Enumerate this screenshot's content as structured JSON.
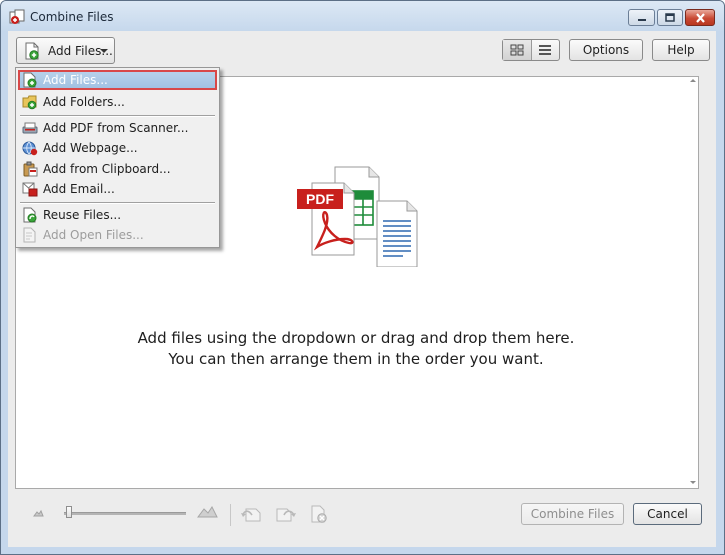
{
  "window": {
    "title": "Combine Files"
  },
  "toolbar": {
    "add_files_label": "Add Files...",
    "options_label": "Options",
    "help_label": "Help"
  },
  "menu": {
    "items": [
      {
        "label": "Add Files...",
        "icon": "add-files-icon",
        "highlighted": true,
        "enabled": true
      },
      {
        "label": "Add Folders...",
        "icon": "add-folder-icon",
        "enabled": true
      },
      {
        "label": "Add PDF from Scanner...",
        "icon": "scanner-icon",
        "enabled": true
      },
      {
        "label": "Add Webpage...",
        "icon": "webpage-icon",
        "enabled": true
      },
      {
        "label": "Add from Clipboard...",
        "icon": "clipboard-icon",
        "enabled": true
      },
      {
        "label": "Add Email...",
        "icon": "email-icon",
        "enabled": true
      },
      {
        "label": "Reuse Files...",
        "icon": "reuse-files-icon",
        "enabled": true
      },
      {
        "label": "Add Open Files...",
        "icon": "open-files-icon",
        "enabled": false
      }
    ]
  },
  "droparea": {
    "icon_label": "PDF",
    "message_line1": "Add files using the dropdown or drag and drop them here.",
    "message_line2": "You can then arrange them in the order you want."
  },
  "footer": {
    "combine_label": "Combine Files",
    "cancel_label": "Cancel"
  },
  "colors": {
    "highlight_border": "#d84848",
    "pdf_red": "#c8201d",
    "spreadsheet_green": "#1e8c3a",
    "doc_blue": "#2f68b0"
  }
}
